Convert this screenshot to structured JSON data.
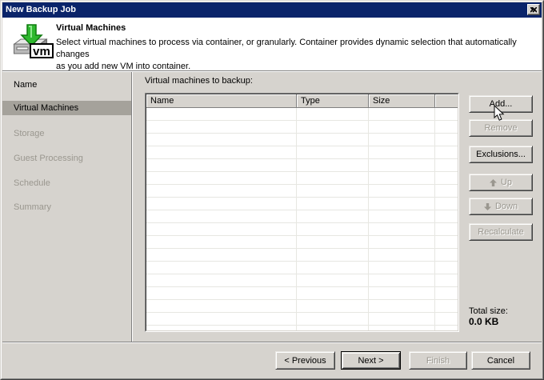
{
  "window": {
    "title": "New Backup Job"
  },
  "header": {
    "title": "Virtual Machines",
    "description_line1": "Select virtual machines to process via container, or granularly. Container provides dynamic selection that automatically changes",
    "description_line2": "as you add new VM into container.",
    "icon_label": "vm"
  },
  "sidebar": {
    "items": [
      {
        "label": "Name",
        "state": "done"
      },
      {
        "label": "Virtual Machines",
        "state": "selected"
      },
      {
        "label": "Storage",
        "state": "upcoming"
      },
      {
        "label": "Guest Processing",
        "state": "upcoming"
      },
      {
        "label": "Schedule",
        "state": "upcoming"
      },
      {
        "label": "Summary",
        "state": "upcoming"
      }
    ]
  },
  "main": {
    "list_label": "Virtual machines to backup:",
    "table": {
      "columns": [
        "Name",
        "Type",
        "Size",
        ""
      ],
      "rows": []
    },
    "side_buttons": [
      {
        "label": "Add...",
        "enabled": true
      },
      {
        "label": "Remove",
        "enabled": false
      },
      {
        "label": "Exclusions...",
        "enabled": true
      },
      {
        "label": "Up",
        "enabled": false,
        "icon": "up-arrow"
      },
      {
        "label": "Down",
        "enabled": false,
        "icon": "down-arrow"
      },
      {
        "label": "Recalculate",
        "enabled": false
      }
    ],
    "total_size_label": "Total size:",
    "total_size_value": "0.0 KB"
  },
  "footer": {
    "buttons": [
      {
        "label": "< Previous",
        "enabled": true
      },
      {
        "label": "Next >",
        "enabled": true,
        "default": true
      },
      {
        "label": "Finish",
        "enabled": false
      },
      {
        "label": "Cancel",
        "enabled": true
      }
    ]
  },
  "colors": {
    "titlebar": "#0a246a",
    "dialog_bg": "#d6d3ce",
    "selected_step_bg": "#a5a29b",
    "disabled_text": "#9a978f",
    "grid_line": "#e7e7e2",
    "arrow_green": "#2eb82e"
  }
}
